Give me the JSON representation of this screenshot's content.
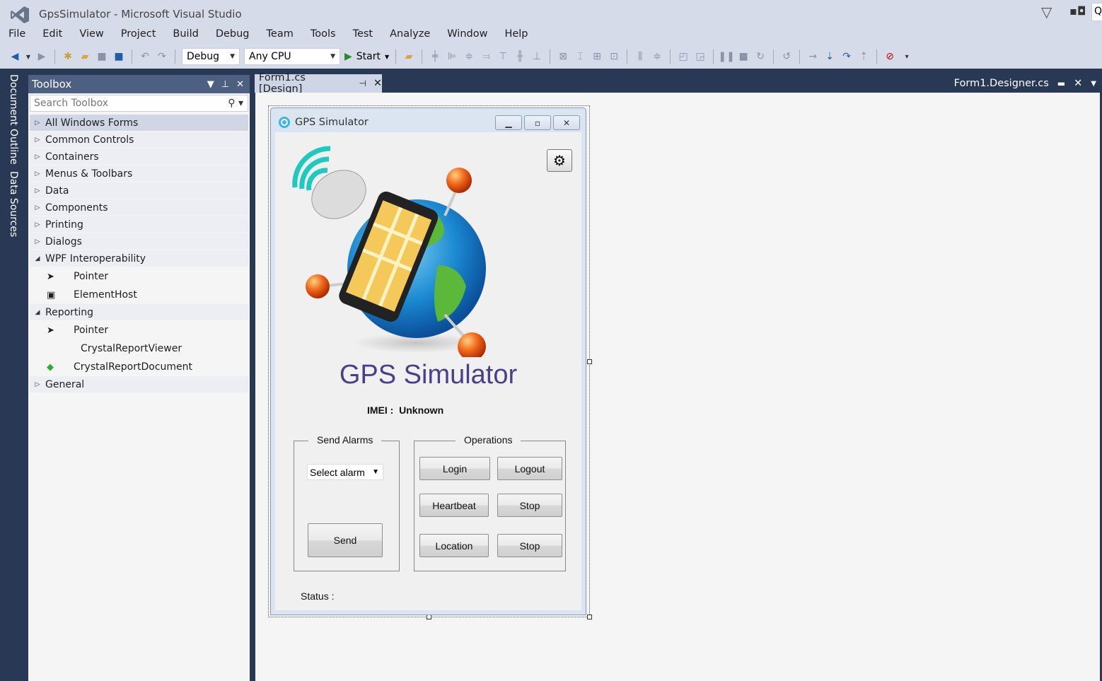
{
  "window": {
    "title": "GpsSimulator - Microsoft Visual Studio"
  },
  "menu": [
    "File",
    "Edit",
    "View",
    "Project",
    "Build",
    "Debug",
    "Team",
    "Tools",
    "Test",
    "Analyze",
    "Window",
    "Help"
  ],
  "toolbar": {
    "config": "Debug",
    "platform": "Any CPU",
    "start_label": "Start"
  },
  "side_tabs": [
    "Document Outline",
    "Data Sources"
  ],
  "toolbox": {
    "title": "Toolbox",
    "search_placeholder": "Search Toolbox",
    "categories": [
      {
        "label": "All Windows Forms",
        "expanded": false
      },
      {
        "label": "Common Controls",
        "expanded": false
      },
      {
        "label": "Containers",
        "expanded": false
      },
      {
        "label": "Menus & Toolbars",
        "expanded": false
      },
      {
        "label": "Data",
        "expanded": false
      },
      {
        "label": "Components",
        "expanded": false
      },
      {
        "label": "Printing",
        "expanded": false
      },
      {
        "label": "Dialogs",
        "expanded": false
      },
      {
        "label": "WPF Interoperability",
        "expanded": true,
        "items": [
          {
            "label": "Pointer",
            "icon": "pointer-icon"
          },
          {
            "label": "ElementHost",
            "icon": "elementhost-icon"
          }
        ]
      },
      {
        "label": "Reporting",
        "expanded": true,
        "items": [
          {
            "label": "Pointer",
            "icon": "pointer-icon"
          },
          {
            "label": "CrystalReportViewer",
            "icon": ""
          },
          {
            "label": "CrystalReportDocument",
            "icon": "crystal-report-icon"
          }
        ]
      },
      {
        "label": "General",
        "expanded": false
      }
    ]
  },
  "tabs": {
    "active": "Form1.cs [Design]",
    "other": "Form1.Designer.cs"
  },
  "form": {
    "title": "GPS Simulator",
    "app_heading": "GPS Simulator",
    "imei_label": "IMEI :",
    "imei_value": "Unknown",
    "send_alarms": {
      "title": "Send Alarms",
      "select_value": "Select alarm",
      "send_label": "Send"
    },
    "operations": {
      "title": "Operations",
      "buttons": [
        "Login",
        "Logout",
        "Heartbeat",
        "Stop",
        "Location",
        "Stop"
      ]
    },
    "status_label": "Status :",
    "colors": {
      "heading": "#4b3f8c"
    }
  }
}
